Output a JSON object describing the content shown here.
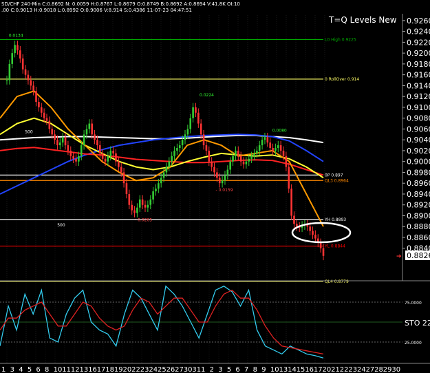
{
  "header": {
    "line1": "SD/CHF  240-Min  C:0.8692  N:  0.0059  H:0.8767  L:0.8679  O:0.8749  B:0.8692  A:0.8694  V:41.8K  OI:10",
    "line2": ".00  C:0.9013  H:0.9018  L:0.8992  O:0.9006  V:8.914  S:0.4386  11-07-23  04:47:51"
  },
  "chart_data": [
    {
      "type": "line",
      "title": "T=Q Levels New",
      "price_axis": {
        "ylim": [
          0.878,
          0.927
        ],
        "ticks": [
          "0.9260",
          "0.9240",
          "0.9220",
          "0.9200",
          "0.9180",
          "0.9160",
          "0.9140",
          "0.9120",
          "0.9100",
          "0.9080",
          "0.9060",
          "0.9040",
          "0.9020",
          "0.9000",
          "0.8980",
          "0.8960",
          "0.8940",
          "0.8920",
          "0.8900",
          "0.8880",
          "0.8860",
          "0.8840"
        ],
        "current_price": "0.8826"
      },
      "x_axis": {
        "labels": [
          "1",
          "3",
          "4",
          "5",
          "6",
          "8",
          "10",
          "11",
          "12",
          "13",
          "16",
          "17",
          "18",
          "19",
          "20",
          "22",
          "23",
          "24",
          "25",
          "26",
          "27",
          "30",
          "31",
          "1",
          "2",
          "3",
          "5",
          "6",
          "7",
          "8",
          "9",
          "10",
          "13",
          "14",
          "15",
          "16",
          "17",
          "20",
          "21",
          "22",
          "23",
          "24",
          "27",
          "28",
          "29",
          "30"
        ]
      },
      "levels": [
        {
          "label": "L0 High  0.9225",
          "value": 0.9225,
          "color": "#00aa00"
        },
        {
          "label": "0 RollOver  0.914",
          "value": 0.9152,
          "color": "#ffff66"
        },
        {
          "label": "0P  0.897",
          "value": 0.8975,
          "color": "#ffffff"
        },
        {
          "label": "QL3  0.8964",
          "value": 0.8965,
          "color": "#ff8800"
        },
        {
          "label": "YH  0.8893",
          "value": 0.8893,
          "color": "#ffffff"
        },
        {
          "label": "YL  0.8844",
          "value": 0.8844,
          "color": "#ff0000"
        },
        {
          "label": "QL4  0.8779",
          "value": 0.8779,
          "color": "#ffff66"
        }
      ],
      "annotations": [
        {
          "text": "0.0134",
          "x_index": 2,
          "value": 0.923
        },
        {
          "text": "500",
          "x_index": 12,
          "value": 0.9052
        },
        {
          "text": "0.0224",
          "x_index": 120,
          "value": 0.912
        },
        {
          "text": "0.0080",
          "x_index": 165,
          "value": 0.9055
        },
        {
          "text": "- 0.0159",
          "x_index": 130,
          "value": 0.8945
        },
        {
          "text": "- 0.0265",
          "x_index": 80,
          "value": 0.889
        },
        {
          "text": "500",
          "x_index": 32,
          "value": 0.888
        }
      ],
      "candles_close": [
        0.915,
        0.918,
        0.92,
        0.9215,
        0.9205,
        0.919,
        0.917,
        0.916,
        0.915,
        0.914,
        0.913,
        0.911,
        0.91,
        0.909,
        0.908,
        0.9075,
        0.906,
        0.905,
        0.904,
        0.903,
        0.9035,
        0.9045,
        0.903,
        0.902,
        0.901,
        0.9005,
        0.9,
        0.901,
        0.903,
        0.905,
        0.906,
        0.907,
        0.905,
        0.904,
        0.903,
        0.9015,
        0.9005,
        0.9,
        0.901,
        0.902,
        0.9015,
        0.9,
        0.899,
        0.898,
        0.896,
        0.894,
        0.892,
        0.891,
        0.8905,
        0.8915,
        0.893,
        0.892,
        0.8915,
        0.892,
        0.893,
        0.8945,
        0.895,
        0.896,
        0.897,
        0.898,
        0.899,
        0.9,
        0.901,
        0.902,
        0.9025,
        0.903,
        0.904,
        0.905,
        0.906,
        0.908,
        0.91,
        0.909,
        0.907,
        0.905,
        0.903,
        0.902,
        0.9,
        0.899,
        0.898,
        0.897,
        0.896,
        0.8965,
        0.8975,
        0.8985,
        0.9,
        0.901,
        0.902,
        0.901,
        0.9,
        0.8995,
        0.9,
        0.9005,
        0.901,
        0.9015,
        0.902,
        0.903,
        0.904,
        0.9045,
        0.9035,
        0.9025,
        0.902,
        0.9025,
        0.903,
        0.902,
        0.901,
        0.899,
        0.895,
        0.89,
        0.8885,
        0.888,
        0.8878,
        0.8882,
        0.8884,
        0.888,
        0.8872,
        0.8865,
        0.8858,
        0.885,
        0.884,
        0.8826
      ],
      "moving_averages": [
        {
          "color": "#ffffff",
          "values": [
            0.904,
            0.9042,
            0.9044,
            0.9045,
            0.9046,
            0.9046,
            0.9045,
            0.9044,
            0.9043,
            0.9042,
            0.9042,
            0.9043,
            0.9045,
            0.9047,
            0.9048,
            0.9048,
            0.9046,
            0.9044,
            0.904,
            0.9035
          ]
        },
        {
          "color": "#2244ff",
          "values": [
            0.894,
            0.8955,
            0.897,
            0.8985,
            0.9,
            0.9012,
            0.9022,
            0.903,
            0.9035,
            0.904,
            0.9043,
            0.9046,
            0.9048,
            0.9049,
            0.905,
            0.9049,
            0.9046,
            0.9038,
            0.902,
            0.9
          ]
        },
        {
          "color": "#ff2222",
          "values": [
            0.902,
            0.9024,
            0.9026,
            0.9022,
            0.9018,
            0.9014,
            0.9012,
            0.9008,
            0.9004,
            0.9002,
            0.9,
            0.8998,
            0.8998,
            0.9,
            0.9002,
            0.9003,
            0.9002,
            0.8995,
            0.8985,
            0.8975
          ]
        },
        {
          "color": "#ffff33",
          "values": [
            0.905,
            0.907,
            0.908,
            0.907,
            0.905,
            0.903,
            0.9015,
            0.9,
            0.899,
            0.8985,
            0.899,
            0.9,
            0.9008,
            0.9015,
            0.9012,
            0.901,
            0.9012,
            0.9005,
            0.899,
            0.897
          ]
        },
        {
          "color": "#ff9900",
          "values": [
            0.908,
            0.912,
            0.913,
            0.91,
            0.906,
            0.903,
            0.9,
            0.898,
            0.8965,
            0.897,
            0.899,
            0.903,
            0.904,
            0.903,
            0.901,
            0.9015,
            0.902,
            0.9,
            0.894,
            0.888
          ]
        }
      ]
    },
    {
      "type": "line",
      "title": "STO",
      "ylim": [
        0,
        100
      ],
      "ticks": [
        "75.0000",
        "25.0000"
      ],
      "label": "STO  22",
      "series": [
        {
          "color": "#33ccee",
          "values": [
            20,
            70,
            40,
            85,
            60,
            90,
            30,
            25,
            60,
            80,
            90,
            50,
            40,
            35,
            20,
            60,
            90,
            80,
            60,
            40,
            95,
            85,
            70,
            50,
            30,
            60,
            90,
            95,
            88,
            70,
            90,
            40,
            20,
            15,
            10,
            20,
            15,
            10,
            8,
            5
          ]
        },
        {
          "color": "#dd2222",
          "values": [
            40,
            55,
            55,
            65,
            70,
            75,
            60,
            45,
            45,
            60,
            75,
            70,
            55,
            45,
            40,
            45,
            65,
            80,
            75,
            60,
            70,
            80,
            80,
            65,
            50,
            50,
            70,
            85,
            90,
            80,
            80,
            65,
            45,
            30,
            20,
            18,
            16,
            14,
            12,
            10
          ]
        }
      ]
    }
  ],
  "colors": {
    "background": "#000000",
    "grid": "#2a2a2a",
    "up": "#33cc33",
    "down": "#ff3333",
    "ellipse": "#ffffff"
  }
}
